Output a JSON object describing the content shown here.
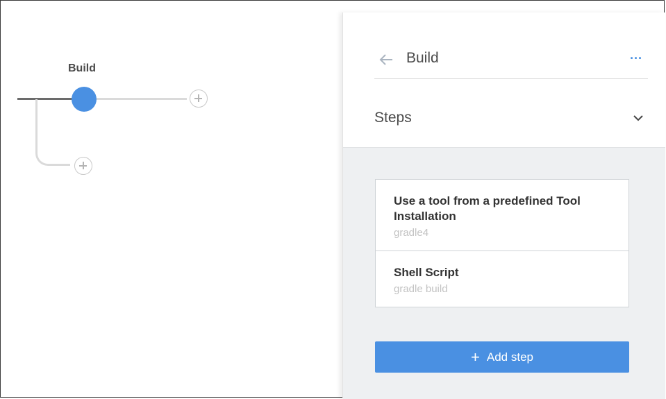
{
  "pipeline": {
    "stage_label": "Build"
  },
  "panel": {
    "header": {
      "title": "Build",
      "back_icon": "arrow-left-icon",
      "more_icon": "more-horizontal-icon",
      "more_text": "···"
    },
    "steps_section": {
      "title": "Steps",
      "chevron_icon": "chevron-down-icon",
      "items": [
        {
          "title": "Use a tool from a predefined Tool Installation",
          "subtitle": "gradle4"
        },
        {
          "title": "Shell Script",
          "subtitle": "gradle build"
        }
      ]
    },
    "add_step": {
      "plus": "+",
      "label": "Add step"
    }
  },
  "colors": {
    "accent": "#4a90e2",
    "steps_background": "#eef0f2",
    "connector": "#dadada"
  }
}
